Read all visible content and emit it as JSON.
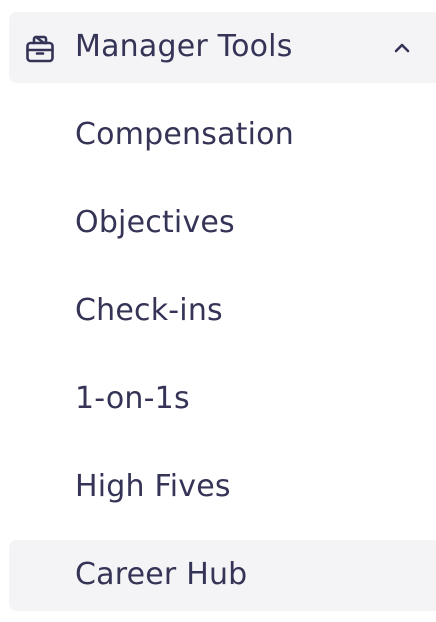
{
  "section": {
    "title": "Manager Tools",
    "icon": "briefcase-icon",
    "expanded_indicator": "chevron-up-icon"
  },
  "items": [
    {
      "label": "Compensation"
    },
    {
      "label": "Objectives"
    },
    {
      "label": "Check-ins"
    },
    {
      "label": "1-on-1s"
    },
    {
      "label": "High Fives"
    },
    {
      "label": "Career Hub"
    }
  ],
  "colors": {
    "text": "#353457",
    "active_bg": "#f4f4f7",
    "page_bg": "#ffffff"
  }
}
